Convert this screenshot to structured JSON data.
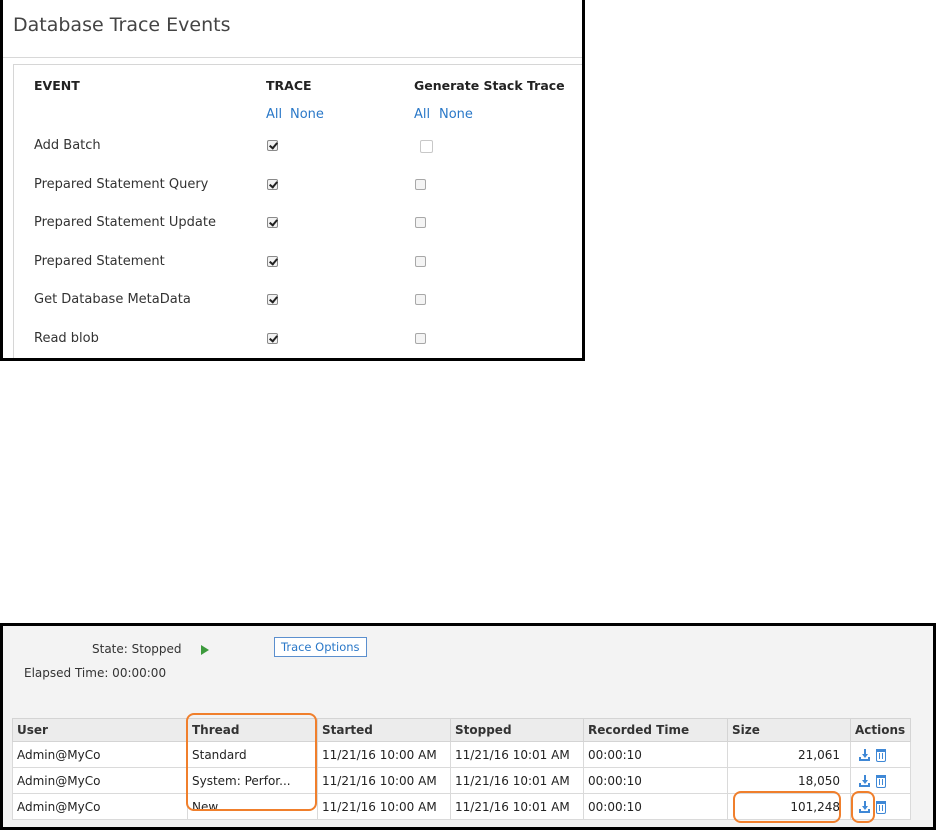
{
  "trace_events": {
    "title": "Database Trace Events",
    "columns": {
      "event": "EVENT",
      "trace": "TRACE",
      "stack": "Generate Stack Trace"
    },
    "trace_links": {
      "all": "All",
      "none": "None"
    },
    "stack_links": {
      "all": "All",
      "none": "None"
    },
    "events": [
      {
        "label": "Add Batch",
        "trace": true,
        "stack": false
      },
      {
        "label": "Prepared Statement Query",
        "trace": true,
        "stack": false
      },
      {
        "label": "Prepared Statement Update",
        "trace": true,
        "stack": false
      },
      {
        "label": "Prepared Statement",
        "trace": true,
        "stack": false
      },
      {
        "label": "Get Database MetaData",
        "trace": true,
        "stack": false
      },
      {
        "label": "Read blob",
        "trace": true,
        "stack": false
      }
    ]
  },
  "tracer": {
    "state_label": "State: Stopped",
    "elapsed_label": "Elapsed Time: 00:00:00",
    "trace_options_label": "Trace Options",
    "headers": [
      "User",
      "Thread",
      "Started",
      "Stopped",
      "Recorded Time",
      "Size",
      "Actions"
    ],
    "rows": [
      {
        "user": "Admin@MyCo",
        "thread": "Standard",
        "started": "11/21/16 10:00 AM",
        "stopped": "11/21/16 10:01 AM",
        "recorded": "00:00:10",
        "size": "21,061"
      },
      {
        "user": "Admin@MyCo",
        "thread": "System: Perfor...",
        "started": "11/21/16 10:00 AM",
        "stopped": "11/21/16 10:01 AM",
        "recorded": "00:00:10",
        "size": "18,050"
      },
      {
        "user": "Admin@MyCo",
        "thread": "New",
        "started": "11/21/16 10:00 AM",
        "stopped": "11/21/16 10:01 AM",
        "recorded": "00:00:10",
        "size": "101,248"
      }
    ],
    "icons": [
      "download-icon",
      "trash-icon"
    ],
    "highlight_color": "#f07f2c",
    "link_color": "#2a78c8"
  }
}
